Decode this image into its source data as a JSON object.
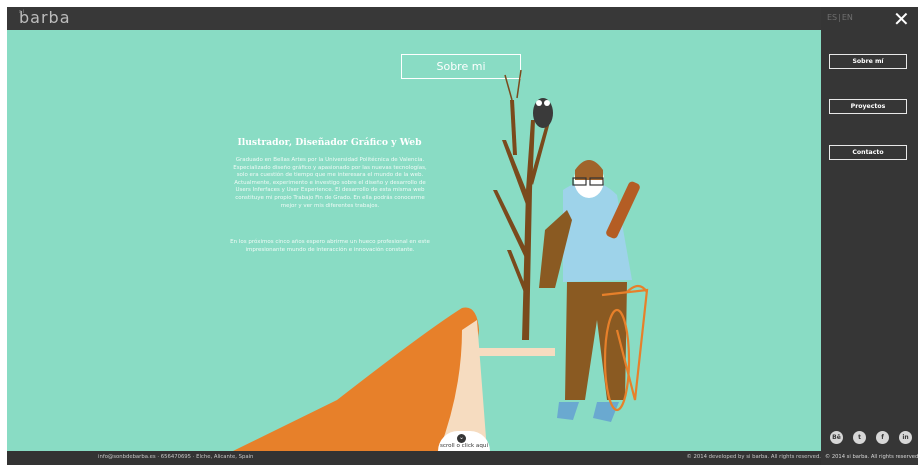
{
  "app": {
    "logo_text": "barba",
    "logo_prefix": "si"
  },
  "header": {
    "lang_es": "ES",
    "lang_sep": "|",
    "lang_en": "EN",
    "close_glyph": "✕"
  },
  "hero": {
    "section_label": "Sobre mi",
    "title": "Ilustrador, Diseñador Gráfico y Web",
    "paragraph1": "Graduado en Bellas Artes por la Universidad Politécnica de Valencia. Especializado diseño gráfico y apasionado por las nuevas tecnologías, solo era cuestión de tiempo que me interesara el mundo de la web. Actualmente, experimento e investigo sobre el diseño y desarrollo de Users Inferfaces y User Experience. El desarrollo de esta misma web constituye mi propio Trabajo Fin de Grado. En ella podrás conocerme mejor y ver mis diferentes trabajos.",
    "paragraph2": "En los próximos cinco años espero abrirme un hueco profesional en este impresionante mundo de interacción e innovación constante.",
    "scroll_label": "scroll o click aquí",
    "scroll_icon": "chevron-down-icon"
  },
  "nav": {
    "items": [
      {
        "label": "Sobre mí"
      },
      {
        "label": "Proyectos"
      },
      {
        "label": "Contacto"
      }
    ]
  },
  "footer": {
    "contact": "info@sonbdebarba.es · 656470695 · Elche, Alicante, Spain",
    "copyright_main": "© 2014 developed by si barba. All rights reserved.",
    "copyright_side": "© 2014 si barba. All rights reserved."
  },
  "social": [
    {
      "icon": "behance-icon",
      "glyph": "Bē"
    },
    {
      "icon": "twitter-icon",
      "glyph": "t"
    },
    {
      "icon": "facebook-icon",
      "glyph": "f"
    },
    {
      "icon": "linkedin-icon",
      "glyph": "in"
    }
  ],
  "colors": {
    "stage_bg": "#89dcc4",
    "orange": "#e7802a",
    "tree_brown": "#7a4a1c",
    "shirt_blue": "#9ed3ea",
    "dark": "#363636"
  }
}
